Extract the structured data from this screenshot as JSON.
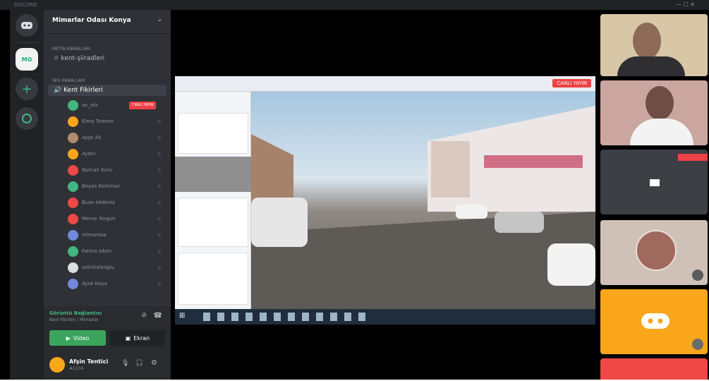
{
  "window": {
    "title": "DISCORD",
    "controls": "—  ☐  ✕"
  },
  "server": {
    "name": "Mimarlar Odası Konya"
  },
  "categories": [
    {
      "label": "METİN KANALLARI"
    },
    {
      "label": "SES KANALLARI"
    }
  ],
  "text_channel": {
    "label": "kent-şiiradleri"
  },
  "voice_channel": {
    "label": "Kent Fikirleri"
  },
  "users": [
    {
      "name": "av_ala",
      "color": "#43b581",
      "badge": "CANLI YAYIN"
    },
    {
      "name": "Elma Tomom",
      "color": "#faa61a"
    },
    {
      "name": "Ayşe Ak",
      "color": "#b28c6e"
    },
    {
      "name": "Aydın",
      "color": "#faa61a"
    },
    {
      "name": "Nurcan Kuru",
      "color": "#f04747"
    },
    {
      "name": "Beyza Korkmaz",
      "color": "#43b581"
    },
    {
      "name": "Buse Akdeniz",
      "color": "#f04747"
    },
    {
      "name": "Merve Yorgun",
      "color": "#f04747"
    },
    {
      "name": "mimarosa",
      "color": "#7289da"
    },
    {
      "name": "Fatma Isken",
      "color": "#43b581"
    },
    {
      "name": "selinkaleoglu",
      "color": "#dcddde"
    },
    {
      "name": "Ayse Kaya",
      "color": "#7289da"
    }
  ],
  "voice_panel": {
    "status": "Görüntü Bağlantısı",
    "sub": "Kent Fikirleri / Mimarlar",
    "video_label": "Video",
    "screen_label": "Ekran"
  },
  "me": {
    "name": "Afşin Tentici",
    "status": "#1234"
  },
  "share": {
    "live_badge": "CANLI YAYIN"
  },
  "colors": {
    "guilds": "#202225",
    "channels": "#2f3136",
    "accent": "#43b581",
    "live": "#ed4245",
    "orange": "#faa61a",
    "red": "#f04747"
  }
}
